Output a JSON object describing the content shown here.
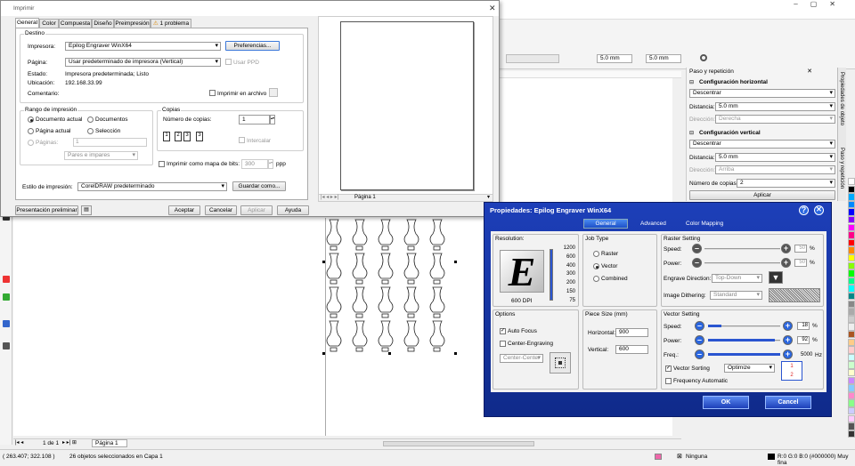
{
  "print_dialog": {
    "title": "Imprimir",
    "tabs": [
      "General",
      "Color",
      "Compuesta",
      "Diseño",
      "Preimpresión",
      "1 problema"
    ],
    "destino": "Destino",
    "impresora_label": "Impresora:",
    "impresora": "Epilog Engraver WinX64",
    "preferencias": "Preferencias...",
    "pagina_label": "Página:",
    "pagina": "Usar predeterminado de impresora (Vertical)",
    "usar_ppd": "Usar PPD",
    "estado_label": "Estado:",
    "estado": "Impresora predeterminada; Listo",
    "ubicacion_label": "Ubicación:",
    "ubicacion": "192.168.33.99",
    "comentario_label": "Comentario:",
    "imprimir_archivo": "Imprimir en archivo",
    "rango": "Rango de impresión",
    "doc_actual": "Documento actual",
    "documentos": "Documentos",
    "pagina_actual": "Página actual",
    "seleccion": "Selección",
    "paginas": "Páginas:",
    "paginas_value": "1",
    "pares": "Pares e impares",
    "copias": "Copias",
    "num_copias": "Número de copias:",
    "num_copias_value": "1",
    "intercalar": "Intercalar",
    "mapa_bits": "Imprimir como mapa de bits:",
    "mapa_value": "300",
    "ppp": "ppp",
    "estilo_label": "Estilo de impresión:",
    "estilo": "CorelDRAW predeterminado",
    "guardar": "Guardar como...",
    "preview_btn": "Presentación preliminar",
    "aceptar": "Aceptar",
    "cancelar": "Cancelar",
    "aplicar": "Aplicar",
    "ayuda": "Ayuda",
    "preview_page": "Página 1"
  },
  "toolbar": {
    "dist1": "5.0 mm",
    "dist2": "5.0 mm"
  },
  "step_panel": {
    "title": "Paso y repetición",
    "horiz": "Configuración horizontal",
    "mode1": "Descentrar",
    "dist_label": "Distancia:",
    "dist1": "5.0 mm",
    "dir_label": "Dirección:",
    "dir1": "Derecha",
    "vert": "Configuración vertical",
    "mode2": "Descentrar",
    "dist2": "5.0 mm",
    "dir2": "Arriba",
    "copies_label": "Número de copias:",
    "copies": "2",
    "apply": "Aplicar",
    "side_tabs": [
      "Propiedades de objeto",
      "Paso y repetición"
    ]
  },
  "epilog": {
    "title": "Propiedades: Epilog Engraver WinX64",
    "tabs": [
      "General",
      "Advanced",
      "Color Mapping"
    ],
    "resolution": "Resolution:",
    "dpi_values": [
      "1200",
      "600",
      "400",
      "300",
      "200",
      "150",
      "75"
    ],
    "dpi": "600 DPI",
    "job_type": "Job Type",
    "raster": "Raster",
    "vector": "Vector",
    "combined": "Combined",
    "raster_setting": "Raster Setting",
    "speed": "Speed:",
    "power": "Power:",
    "r_speed": "50",
    "r_power": "50",
    "engrave_dir": "Engrave Direction:",
    "engrave_dir_value": "Top-Down",
    "dithering": "Image Dithering:",
    "dithering_value": "Standard",
    "options": "Options",
    "auto_focus": "Auto Focus",
    "center_eng": "Center-Engraving",
    "center_value": "Center-Center",
    "piece_size": "Piece Size (mm)",
    "horizontal": "Horizontal:",
    "h_value": "900",
    "vertical": "Vertical:",
    "v_value": "600",
    "vector_setting": "Vector Setting",
    "v_speed": "18",
    "v_power": "92",
    "freq": "Freq.:",
    "v_freq": "5000",
    "hz": "Hz",
    "pct": "%",
    "vector_sorting": "Vector Sorting",
    "sorting_value": "Optimize",
    "freq_auto": "Frequency Automatic",
    "ok": "OK",
    "cancel": "Cancel"
  },
  "status": {
    "coords": "( 263.407; 322.108 )",
    "selection": "26 objetos seleccionados en Capa 1",
    "page_of": "1 de 1",
    "page_tab": "Página 1",
    "fill": "Ninguna",
    "color": "R:0 G:0 B:0 (#000000) Muy fina"
  }
}
